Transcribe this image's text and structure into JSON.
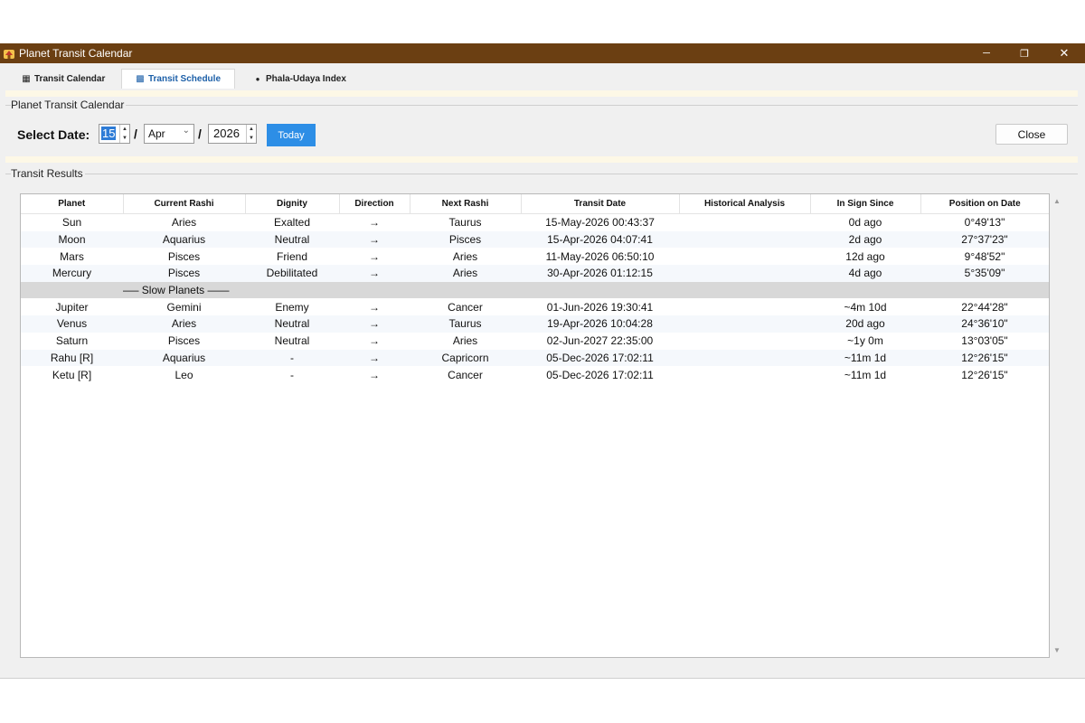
{
  "window": {
    "title": "Planet Transit Calendar",
    "app_icon": "house-icon",
    "controls": {
      "minimize": "─",
      "restore": "❐",
      "close": "✕"
    },
    "titlebar_color": "#6b3f12"
  },
  "tabs": [
    {
      "label": "Transit Calendar",
      "icon": "calendar-icon",
      "glyph": "▦",
      "active": false
    },
    {
      "label": "Transit Schedule",
      "icon": "schedule-icon",
      "glyph": "▩",
      "active": true
    },
    {
      "label": "Phala-Udaya Index",
      "icon": "dot-icon",
      "glyph": "●",
      "active": false
    }
  ],
  "date_group": {
    "title": "Planet Transit Calendar",
    "select_label": "Select Date:",
    "day": "15",
    "month": "Apr",
    "year": "2026",
    "separator": "/",
    "today_label": "Today",
    "close_label": "Close"
  },
  "results": {
    "title": "Transit Results",
    "columns": [
      "Planet",
      "Current Rashi",
      "Dignity",
      "Direction",
      "Next Rashi",
      "Transit Date",
      "Historical Analysis",
      "In Sign Since",
      "Position on Date"
    ],
    "rows": [
      [
        "Sun",
        "Aries",
        "Exalted",
        "→",
        "Taurus",
        "15-May-2026 00:43:37",
        "",
        "0d ago",
        "0°49'13\""
      ],
      [
        "Moon",
        "Aquarius",
        "Neutral",
        "→",
        "Pisces",
        "15-Apr-2026 04:07:41",
        "",
        "2d ago",
        "27°37'23\""
      ],
      [
        "Mars",
        "Pisces",
        "Friend",
        "→",
        "Aries",
        "11-May-2026 06:50:10",
        "",
        "12d ago",
        "9°48'52\""
      ],
      [
        "Mercury",
        "Pisces",
        "Debilitated",
        "→",
        "Aries",
        "30-Apr-2026 01:12:15",
        "",
        "4d ago",
        "5°35'09\""
      ]
    ],
    "section_label": "—— Slow Planets ——",
    "slow_rows": [
      [
        "Jupiter",
        "Gemini",
        "Enemy",
        "→",
        "Cancer",
        "01-Jun-2026 19:30:41",
        "",
        "~4m 10d",
        "22°44'28\""
      ],
      [
        "Venus",
        "Aries",
        "Neutral",
        "→",
        "Taurus",
        "19-Apr-2026 10:04:28",
        "",
        "20d ago",
        "24°36'10\""
      ],
      [
        "Saturn",
        "Pisces",
        "Neutral",
        "→",
        "Aries",
        "02-Jun-2027 22:35:00",
        "",
        "~1y 0m",
        "13°03'05\""
      ],
      [
        "Rahu [R]",
        "Aquarius",
        "-",
        "→",
        "Capricorn",
        "05-Dec-2026 17:02:11",
        "",
        "~11m 1d",
        "12°26'15\""
      ],
      [
        "Ketu [R]",
        "Leo",
        "-",
        "→",
        "Cancer",
        "05-Dec-2026 17:02:11",
        "",
        "~11m 1d",
        "12°26'15\""
      ]
    ]
  },
  "colors": {
    "accent": "#2d8ee6",
    "active_tab_text": "#1c5fa8",
    "section_row": "#d8d8d8"
  }
}
